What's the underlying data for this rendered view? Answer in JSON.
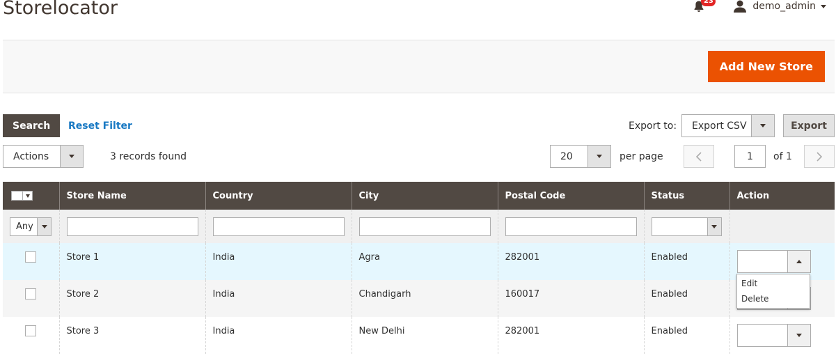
{
  "page": {
    "title": "Storelocator"
  },
  "header": {
    "notifications_count": "23",
    "username": "demo_admin"
  },
  "actions_bar": {
    "add_button": "Add New Store"
  },
  "toolbar": {
    "search_button": "Search",
    "reset_filter": "Reset Filter",
    "export_label": "Export to:",
    "export_format": "Export CSV",
    "export_button": "Export",
    "mass_actions": "Actions",
    "records_found": "3 records found",
    "per_page_value": "20",
    "per_page_label": "per page",
    "current_page": "1",
    "of_pages": "of 1"
  },
  "grid": {
    "columns": [
      "Store Name",
      "Country",
      "City",
      "Postal Code",
      "Status",
      "Action"
    ],
    "filter_any": "Any",
    "rows": [
      {
        "store_name": "Store 1",
        "country": "India",
        "city": "Agra",
        "postal_code": "282001",
        "status": "Enabled"
      },
      {
        "store_name": "Store 2",
        "country": "India",
        "city": "Chandigarh",
        "postal_code": "160017",
        "status": "Enabled"
      },
      {
        "store_name": "Store 3",
        "country": "India",
        "city": "New Delhi",
        "postal_code": "282001",
        "status": "Enabled"
      }
    ],
    "action_menu": [
      "Edit",
      "Delete"
    ]
  },
  "colors": {
    "primary": "#eb5202",
    "header_bg": "#514943",
    "link": "#1979c3",
    "badge": "#e22626"
  },
  "icons": [
    "bell-icon",
    "user-icon",
    "chevron-left-icon",
    "chevron-right-icon"
  ]
}
